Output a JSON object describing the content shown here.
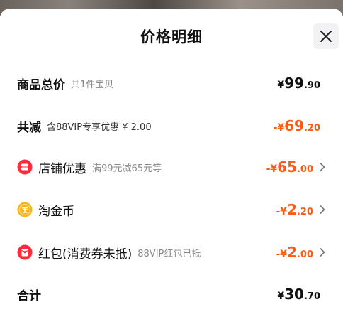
{
  "title": "价格明细",
  "rows": {
    "total": {
      "label": "商品总价",
      "sub": "共1件宝贝",
      "amount": {
        "sym": "¥",
        "int": "99",
        "dec": ".90"
      }
    },
    "reduction": {
      "label": "共减",
      "sub": "含88VIP专享优惠 ¥ 2.00",
      "amount": {
        "sym": "-¥",
        "int": "69",
        "dec": ".20"
      }
    },
    "shop": {
      "label": "店铺优惠",
      "sub": "满99元减65元等",
      "icon": "shop-coupon-icon",
      "amount": {
        "sym": "-¥",
        "int": "65",
        "dec": ".00"
      }
    },
    "coins": {
      "label": "淘金币",
      "icon": "gold-coin-icon",
      "amount": {
        "sym": "-¥",
        "int": "2",
        "dec": ".20"
      }
    },
    "redpacket": {
      "label": "红包(消费券未抵)",
      "sub": "88VIP红包已抵",
      "icon": "red-packet-icon",
      "amount": {
        "sym": "-¥",
        "int": "2",
        "dec": ".00"
      }
    },
    "sum": {
      "label": "合计",
      "amount": {
        "sym": "¥",
        "int": "30",
        "dec": ".70"
      }
    }
  },
  "colors": {
    "accent": "#ff5a14",
    "text": "#111111",
    "muted": "#888888"
  }
}
